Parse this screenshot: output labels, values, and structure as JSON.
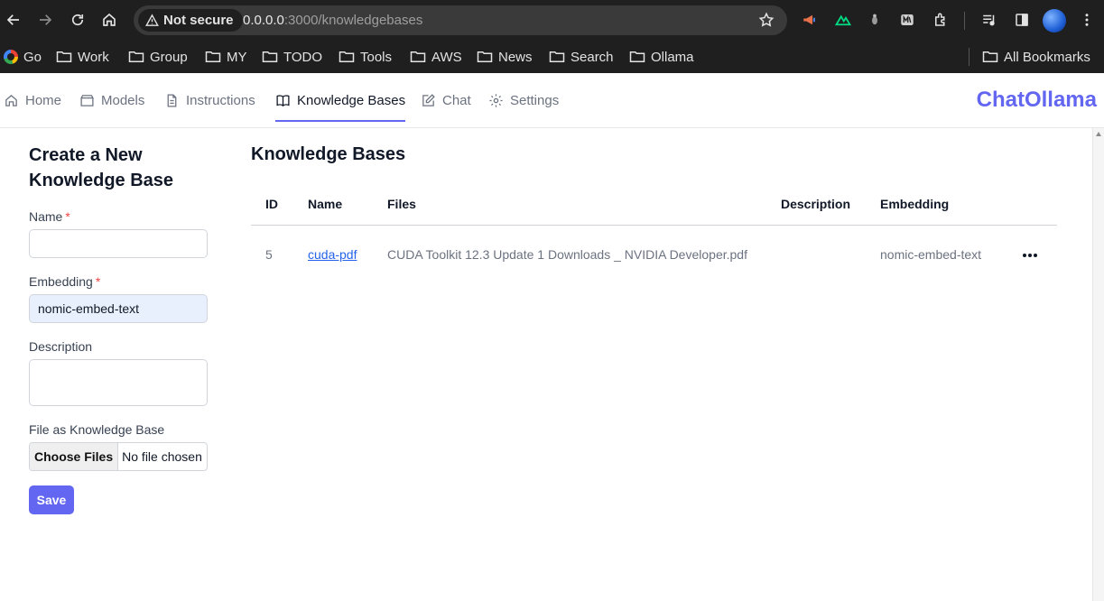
{
  "browser": {
    "security_label": "Not secure",
    "url_host": "0.0.0.0",
    "url_rest": ":3000/knowledgebases",
    "bookmarks": [
      "Go",
      "Work",
      "Group",
      "MY",
      "TODO",
      "Tools",
      "AWS",
      "News",
      "Search",
      "Ollama"
    ],
    "all_bookmarks": "All Bookmarks"
  },
  "nav": {
    "items": [
      "Home",
      "Models",
      "Instructions",
      "Knowledge Bases",
      "Chat",
      "Settings"
    ],
    "active": "Knowledge Bases",
    "brand": "ChatOllama",
    "brand_color": "#6366f1"
  },
  "form": {
    "title": "Create a New Knowledge Base",
    "name_label": "Name",
    "name_value": "",
    "embedding_label": "Embedding",
    "embedding_value": "nomic-embed-text",
    "description_label": "Description",
    "description_value": "",
    "file_label": "File as Knowledge Base",
    "file_button": "Choose Files",
    "file_status": "No file chosen",
    "required_mark": "*",
    "save_label": "Save"
  },
  "table": {
    "title": "Knowledge Bases",
    "columns": [
      "ID",
      "Name",
      "Files",
      "Description",
      "Embedding"
    ],
    "rows": [
      {
        "id": "5",
        "name": "cuda-pdf",
        "files": "CUDA Toolkit 12.3 Update 1 Downloads _ NVIDIA Developer.pdf",
        "description": "",
        "embedding": "nomic-embed-text"
      }
    ]
  }
}
